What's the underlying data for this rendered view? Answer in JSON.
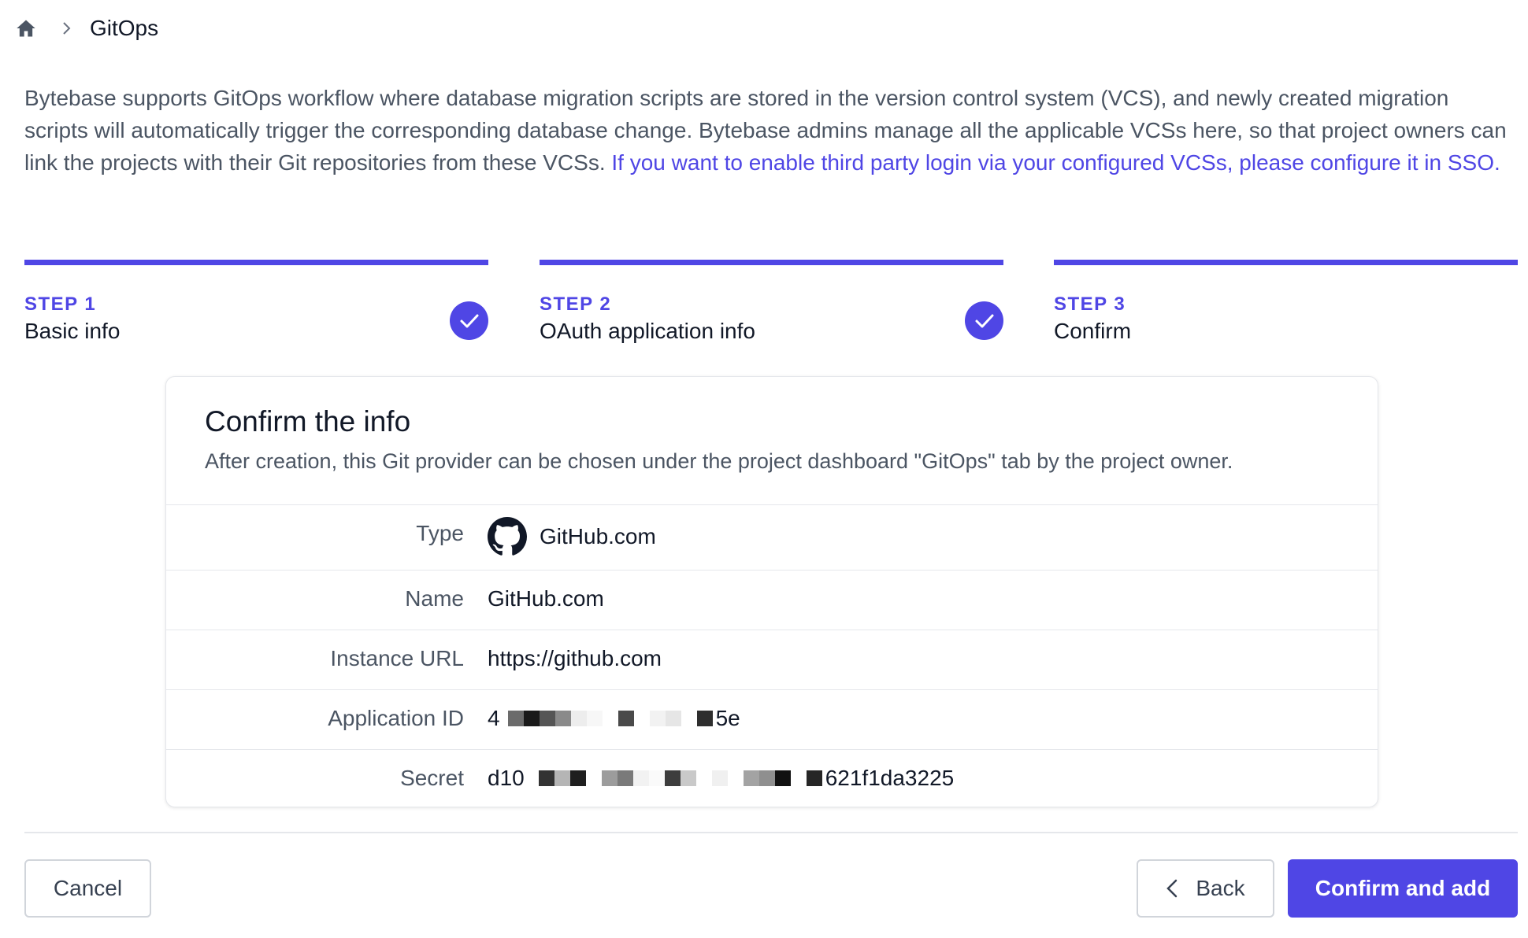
{
  "breadcrumb": {
    "home_icon": "home-icon",
    "current": "GitOps"
  },
  "intro": {
    "text": "Bytebase supports GitOps workflow where database migration scripts are stored in the version control system (VCS), and newly created migration scripts will automatically trigger the corresponding database change. Bytebase admins manage all the applicable VCSs here, so that project owners can link the projects with their Git repositories from these VCSs. ",
    "link": "If you want to enable third party login via your configured VCSs, please configure it in SSO."
  },
  "steps": [
    {
      "number": "STEP 1",
      "title": "Basic info",
      "completed": true
    },
    {
      "number": "STEP 2",
      "title": "OAuth application info",
      "completed": true
    },
    {
      "number": "STEP 3",
      "title": "Confirm",
      "completed": false
    }
  ],
  "confirm": {
    "title": "Confirm the info",
    "subtitle": "After creation, this Git provider can be chosen under the project dashboard \"GitOps\" tab by the project owner.",
    "rows": [
      {
        "label": "Type",
        "value": "GitHub.com",
        "icon": "github-icon"
      },
      {
        "label": "Name",
        "value": "GitHub.com"
      },
      {
        "label": "Instance URL",
        "value": "https://github.com"
      },
      {
        "label": "Application ID",
        "value_prefix": "4",
        "value_suffix": "5e"
      },
      {
        "label": "Secret",
        "value_prefix": "d10",
        "value_suffix": "621f1da3225"
      }
    ]
  },
  "buttons": {
    "cancel": "Cancel",
    "back": "Back",
    "confirm": "Confirm and add"
  },
  "colors": {
    "accent": "#4f46e5",
    "text_muted": "#4b5563",
    "border": "#e5e7eb"
  }
}
